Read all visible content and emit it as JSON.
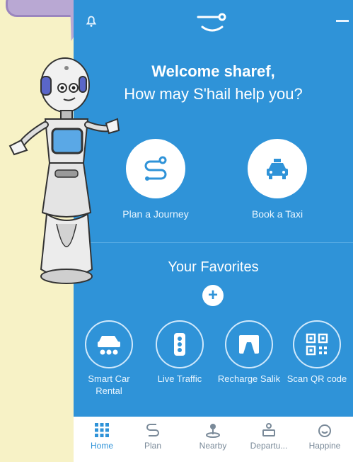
{
  "header": {
    "title": "Welcome sharef,",
    "subtitle": "How may S'hail help you?"
  },
  "actions": [
    {
      "label": "Plan a Journey",
      "icon": "route-icon"
    },
    {
      "label": "Book a Taxi",
      "icon": "taxi-icon"
    }
  ],
  "favorites": {
    "title": "Your Favorites",
    "add_symbol": "+",
    "items": [
      {
        "label": "Smart Car Rental",
        "icon": "car-rental-icon"
      },
      {
        "label": "Live Traffic",
        "icon": "traffic-light-icon"
      },
      {
        "label": "Recharge Salik",
        "icon": "salik-icon"
      },
      {
        "label": "Scan QR code",
        "icon": "qr-code-icon"
      }
    ]
  },
  "tabs": [
    {
      "label": "Home",
      "icon": "grid-icon",
      "active": true
    },
    {
      "label": "Plan",
      "icon": "route-icon"
    },
    {
      "label": "Nearby",
      "icon": "location-icon"
    },
    {
      "label": "Departu...",
      "icon": "departures-icon"
    },
    {
      "label": "Happine",
      "icon": "smiley-icon"
    }
  ],
  "colors": {
    "primary": "#2f93d8",
    "background": "#f7f2c6",
    "bubble": "#b9a8d3",
    "accent": "#ef7a7a"
  }
}
